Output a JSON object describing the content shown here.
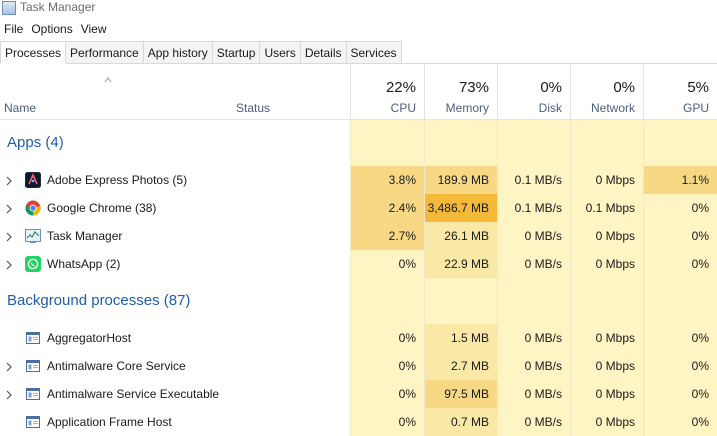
{
  "window": {
    "title": "Task Manager"
  },
  "menu": [
    "File",
    "Options",
    "View"
  ],
  "tabs": [
    "Processes",
    "Performance",
    "App history",
    "Startup",
    "Users",
    "Details",
    "Services"
  ],
  "active_tab": "Processes",
  "columns": {
    "name": "Name",
    "status": "Status",
    "cpu": {
      "pct": "22%",
      "label": "CPU"
    },
    "memory": {
      "pct": "73%",
      "label": "Memory"
    },
    "disk": {
      "pct": "0%",
      "label": "Disk"
    },
    "network": {
      "pct": "0%",
      "label": "Network"
    },
    "gpu": {
      "pct": "5%",
      "label": "GPU"
    }
  },
  "colors": {
    "heat_light": "#fff4c4",
    "heat_mid": "#f9e8a6",
    "heat_high": "#f7d885",
    "heat_max": "#f5b93a",
    "group_text": "#1f5ea8"
  },
  "groups": [
    {
      "title": "Apps (4)",
      "rows": [
        {
          "name": "Adobe Express Photos (5)",
          "icon": "adobe-express-icon",
          "cpu": "3.8%",
          "memory": "189.9 MB",
          "disk": "0.1 MB/s",
          "network": "0 Mbps",
          "gpu": "1.1%",
          "expandable": true
        },
        {
          "name": "Google Chrome (38)",
          "icon": "chrome-icon",
          "cpu": "2.4%",
          "memory": "3,486.7 MB",
          "disk": "0.1 MB/s",
          "network": "0.1 Mbps",
          "gpu": "0%",
          "expandable": true
        },
        {
          "name": "Task Manager",
          "icon": "task-manager-icon",
          "cpu": "2.7%",
          "memory": "26.1 MB",
          "disk": "0 MB/s",
          "network": "0 Mbps",
          "gpu": "0%",
          "expandable": true
        },
        {
          "name": "WhatsApp (2)",
          "icon": "whatsapp-icon",
          "cpu": "0%",
          "memory": "22.9 MB",
          "disk": "0 MB/s",
          "network": "0 Mbps",
          "gpu": "0%",
          "expandable": true
        }
      ]
    },
    {
      "title": "Background processes (87)",
      "rows": [
        {
          "name": "AggregatorHost",
          "icon": "app-window-icon",
          "cpu": "0%",
          "memory": "1.5 MB",
          "disk": "0 MB/s",
          "network": "0 Mbps",
          "gpu": "0%",
          "expandable": false
        },
        {
          "name": "Antimalware Core Service",
          "icon": "app-window-icon",
          "cpu": "0%",
          "memory": "2.7 MB",
          "disk": "0 MB/s",
          "network": "0 Mbps",
          "gpu": "0%",
          "expandable": true
        },
        {
          "name": "Antimalware Service Executable",
          "icon": "app-window-icon",
          "cpu": "0%",
          "memory": "97.5 MB",
          "disk": "0 MB/s",
          "network": "0 Mbps",
          "gpu": "0%",
          "expandable": true
        },
        {
          "name": "Application Frame Host",
          "icon": "app-window-icon",
          "cpu": "0%",
          "memory": "0.7 MB",
          "disk": "0 MB/s",
          "network": "0 Mbps",
          "gpu": "0%",
          "expandable": false
        }
      ]
    }
  ]
}
